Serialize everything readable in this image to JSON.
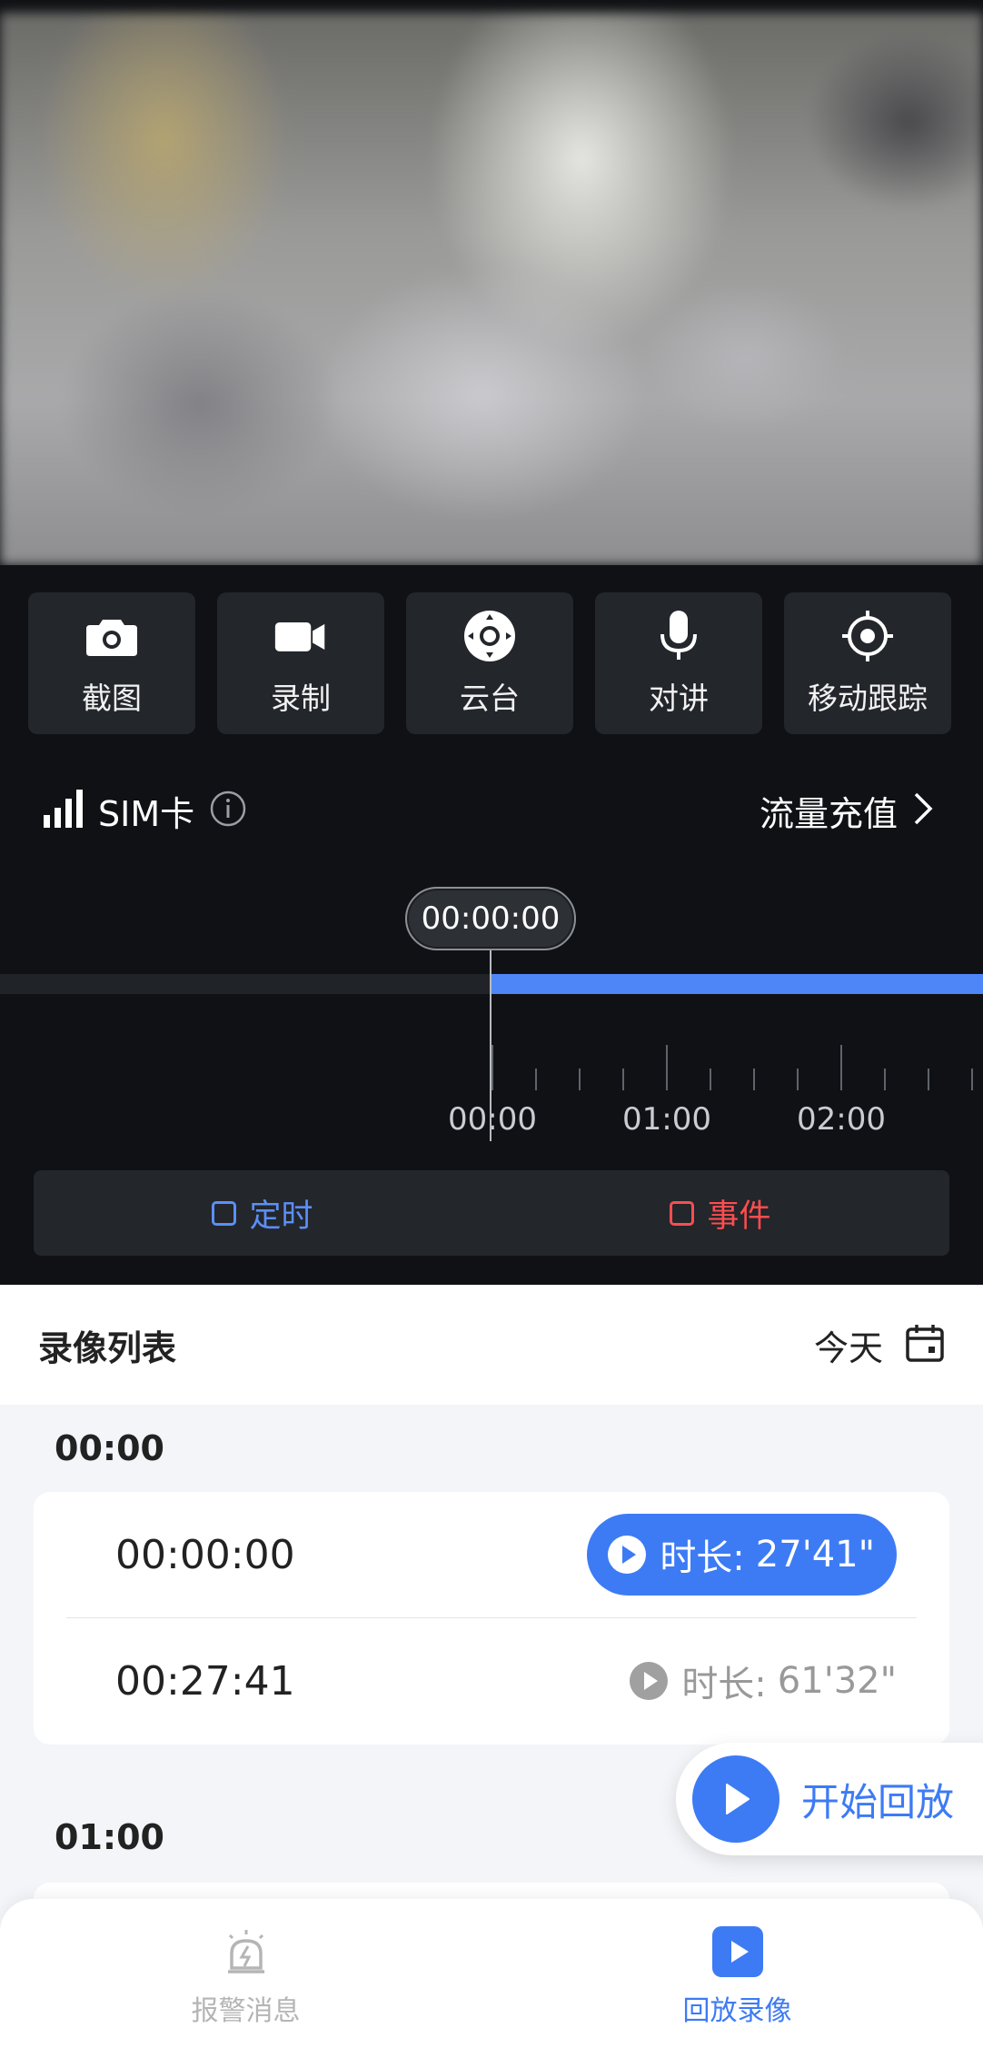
{
  "video": {
    "icon": "camera-feed"
  },
  "toolbar": {
    "items": [
      {
        "label": "截图",
        "icon": "camera-icon"
      },
      {
        "label": "录制",
        "icon": "video-camera-icon"
      },
      {
        "label": "云台",
        "icon": "ptz-joystick-icon"
      },
      {
        "label": "对讲",
        "icon": "microphone-icon"
      },
      {
        "label": "移动跟踪",
        "icon": "target-icon"
      }
    ]
  },
  "sim": {
    "label": "SIM卡",
    "recharge": "流量充值"
  },
  "timeline": {
    "current": "00:00:00",
    "ticks": [
      "00:00",
      "01:00",
      "02:00"
    ],
    "filters": {
      "timed": "定时",
      "event": "事件"
    }
  },
  "records": {
    "title": "录像列表",
    "date": "今天",
    "groups": [
      {
        "hour": "00:00",
        "items": [
          {
            "time": "00:00:00",
            "duration_label": "时长:",
            "duration": "27'41\"",
            "active": true
          },
          {
            "time": "00:27:41",
            "duration_label": "时长:",
            "duration": "61'32\"",
            "active": false
          }
        ]
      },
      {
        "hour": "01:00",
        "items": []
      }
    ],
    "start_playback": "开始回放"
  },
  "nav": {
    "alarm": "报警消息",
    "playback": "回放录像"
  },
  "colors": {
    "accent": "#3d7bf5",
    "timed": "#5b8ff9",
    "event": "#ff4d4f"
  }
}
